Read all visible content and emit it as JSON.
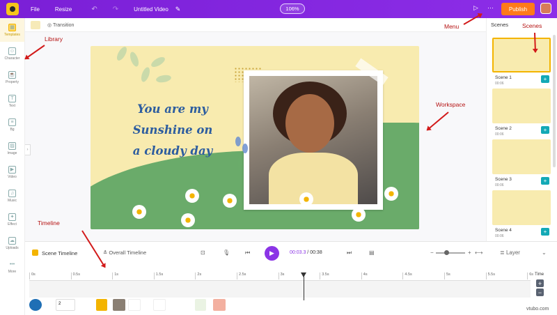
{
  "topbar": {
    "file": "File",
    "resize": "Resize",
    "undo_icon": "↶",
    "redo_icon": "↷",
    "title": "Untitled Video",
    "edit_icon": "✎",
    "zoom": "106%",
    "preview_icon": "▷",
    "share_icon": "⋯",
    "publish": "Publish"
  },
  "sidebar": [
    {
      "label": "Templates",
      "icon": "templates-icon",
      "glyph": "▦"
    },
    {
      "label": "Character",
      "icon": "character-icon",
      "glyph": "☺"
    },
    {
      "label": "Property",
      "icon": "property-icon",
      "glyph": "☕"
    },
    {
      "label": "Text",
      "icon": "text-icon",
      "glyph": "T"
    },
    {
      "label": "Bg",
      "icon": "bg-icon",
      "glyph": "≡"
    },
    {
      "label": "Image",
      "icon": "image-icon",
      "glyph": "▨"
    },
    {
      "label": "Video",
      "icon": "video-icon",
      "glyph": "▶"
    },
    {
      "label": "Music",
      "icon": "music-icon",
      "glyph": "♫"
    },
    {
      "label": "Effect",
      "icon": "effect-icon",
      "glyph": "✦"
    },
    {
      "label": "Uploads",
      "icon": "uploads-icon",
      "glyph": "☁"
    },
    {
      "label": "More",
      "icon": "more-icon",
      "glyph": "•••"
    }
  ],
  "subbar": {
    "transition": "Transition"
  },
  "stage": {
    "line1": "You are my",
    "line2": "Sunshine on",
    "line3": "a cloudy day"
  },
  "annotations": {
    "library": "Library",
    "menu": "Menu",
    "scenes": "Scenes",
    "workspace": "Workspace",
    "timeline": "Timeline"
  },
  "scenes_panel": {
    "title": "Scenes",
    "items": [
      {
        "label": "Scene 1",
        "duration": "00:06"
      },
      {
        "label": "Scene 2",
        "duration": "00:06"
      },
      {
        "label": "Scene 3",
        "duration": "00:06"
      },
      {
        "label": "Scene 4",
        "duration": "00:06"
      }
    ]
  },
  "timeline": {
    "scene_tab": "Scene Timeline",
    "overall_tab": "Overall Timeline",
    "current_time": "00:03.3",
    "separator": " / ",
    "total_time": "00:38",
    "layer": "Layer",
    "time_label": "Time",
    "plus": "+",
    "minus": "−",
    "ticks": [
      "0s",
      "0.5s",
      "1s",
      "1.5s",
      "2s",
      "2.5s",
      "3s",
      "3.5s",
      "4s",
      "4.5s",
      "5s",
      "5.5s",
      "6s"
    ],
    "layer_count": "2"
  },
  "watermark": "vtubo.com",
  "colors": {
    "brand": "#8b34e6",
    "publish": "#ff7a1a",
    "scene_bg": "#f8ebaf",
    "accent": "#13a9b6"
  }
}
